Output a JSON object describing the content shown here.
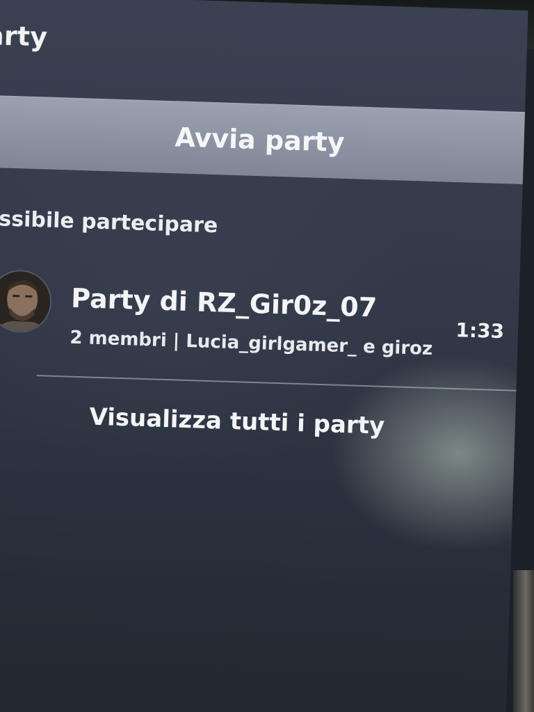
{
  "header": {
    "title": "arty"
  },
  "start_button": {
    "label": "Avvia party"
  },
  "joinable_section": {
    "heading": "ossibile partecipare",
    "parties": [
      {
        "name": "Party di RZ_Gir0z_07",
        "members": "2 membri | Lucia_girlgamer_ e giroz",
        "time": "1:33"
      }
    ]
  },
  "footer": {
    "view_all_label": "Visualizza tutti i party"
  },
  "colors": {
    "panel_top": "#3a4152",
    "panel_bottom": "#23272f",
    "button_bg": "#9aa2b2",
    "text": "#f4f4f6"
  }
}
